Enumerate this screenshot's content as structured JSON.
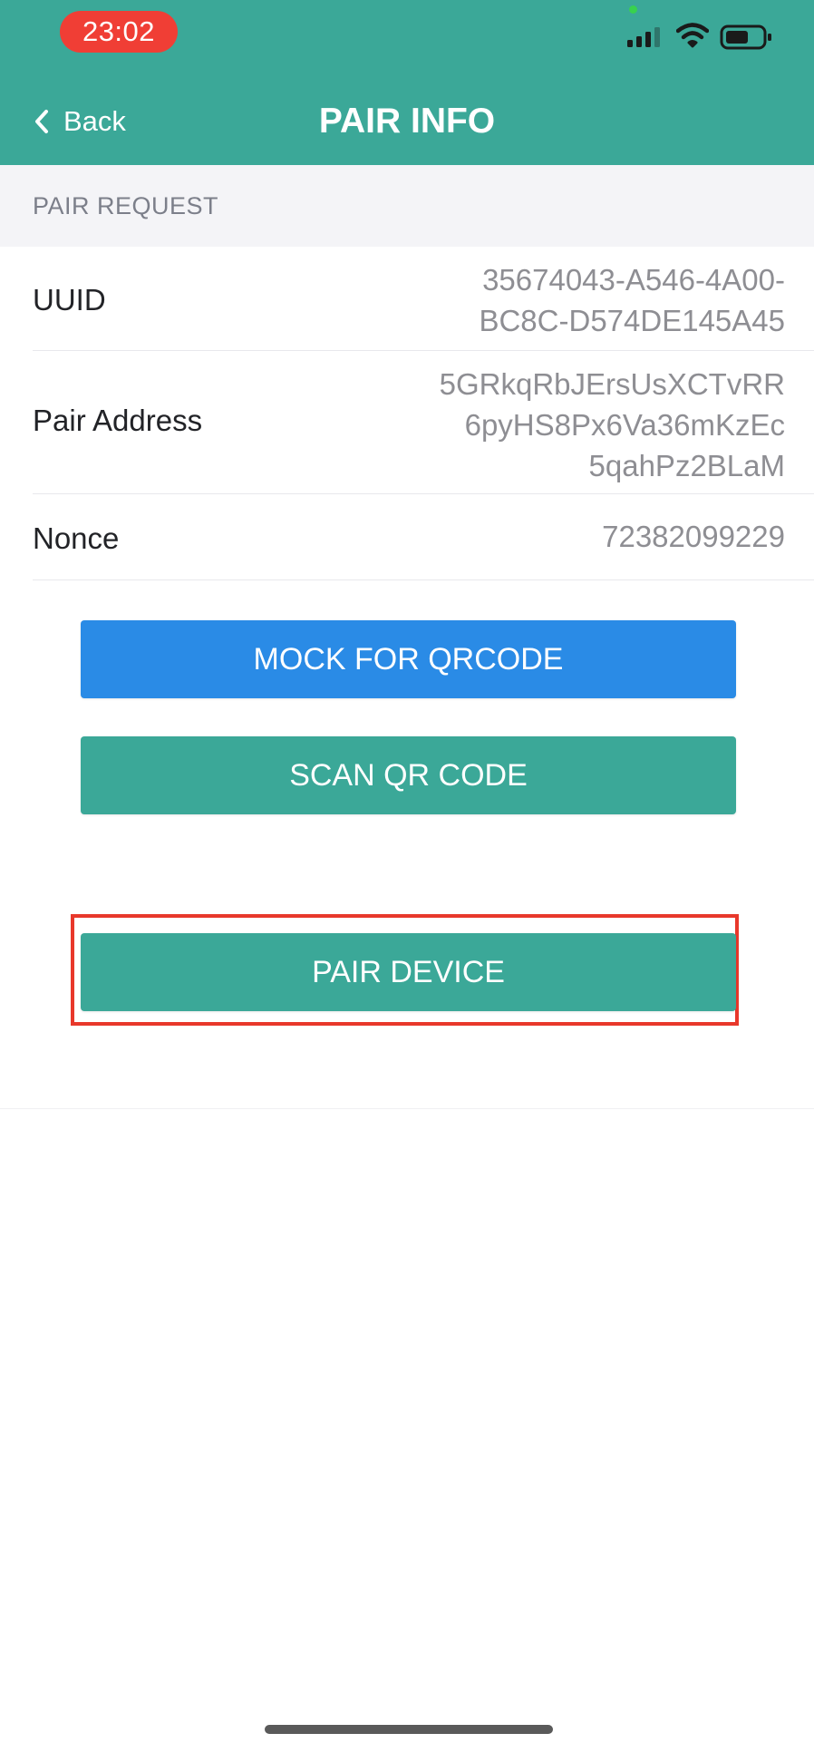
{
  "status_bar": {
    "time": "23:02"
  },
  "nav": {
    "back_label": "Back",
    "title": "PAIR INFO"
  },
  "section": {
    "header": "PAIR REQUEST"
  },
  "rows": [
    {
      "label": "UUID",
      "value": "35674043-A546-4A00-\nBC8C-D574DE145A45"
    },
    {
      "label": "Pair Address",
      "value": "5GRkqRbJErsUsXCTvRR\n6pyHS8Px6Va36mKzEc\n5qahPz2BLaM"
    },
    {
      "label": "Nonce",
      "value": "72382099229"
    }
  ],
  "buttons": {
    "mock_label": "MOCK FOR QRCODE",
    "scan_label": "SCAN QR CODE",
    "pair_label": "PAIR DEVICE"
  },
  "colors": {
    "header": "#3ba898",
    "primary_blue": "#2a8be6",
    "primary_teal": "#3ba898",
    "highlight": "#e8382b",
    "time_pill": "#f03e35"
  },
  "icons": {
    "back": "chevron-left-icon",
    "signal": "cellular-signal-icon",
    "wifi": "wifi-icon",
    "battery": "battery-icon"
  }
}
